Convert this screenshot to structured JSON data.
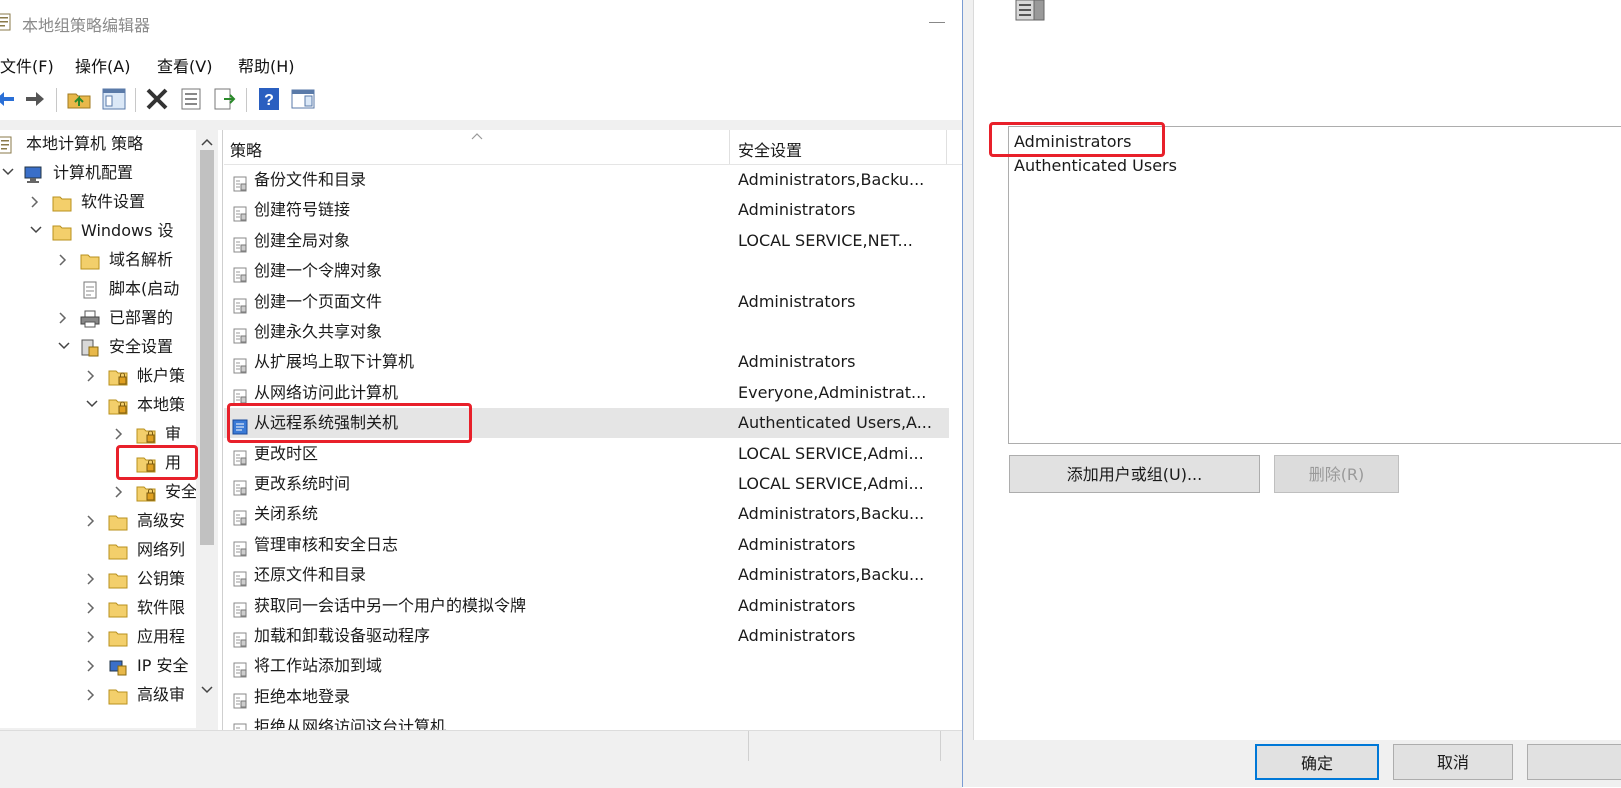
{
  "window": {
    "title": "本地组策略编辑器"
  },
  "menu": {
    "file": "文件(F)",
    "action": "操作(A)",
    "view": "查看(V)",
    "help": "帮助(H)"
  },
  "tree": {
    "items": [
      {
        "label": "本地计算机 策略"
      },
      {
        "label": "计算机配置"
      },
      {
        "label": "软件设置"
      },
      {
        "label": "Windows 设"
      },
      {
        "label": "域名解析"
      },
      {
        "label": "脚本(启动"
      },
      {
        "label": "已部署的"
      },
      {
        "label": "安全设置"
      },
      {
        "label": "帐户策"
      },
      {
        "label": "本地策"
      },
      {
        "label": "审"
      },
      {
        "label": "用"
      },
      {
        "label": "安全"
      },
      {
        "label": "高级安"
      },
      {
        "label": "网络列"
      },
      {
        "label": "公钥策"
      },
      {
        "label": "软件限"
      },
      {
        "label": "应用程"
      },
      {
        "label": "IP 安全"
      },
      {
        "label": "高级审"
      }
    ]
  },
  "list": {
    "col_policy": "策略",
    "col_setting": "安全设置",
    "rows": [
      {
        "name": "备份文件和目录",
        "setting": "Administrators,Backu..."
      },
      {
        "name": "创建符号链接",
        "setting": "Administrators"
      },
      {
        "name": "创建全局对象",
        "setting": "LOCAL SERVICE,NET..."
      },
      {
        "name": "创建一个令牌对象",
        "setting": ""
      },
      {
        "name": "创建一个页面文件",
        "setting": "Administrators"
      },
      {
        "name": "创建永久共享对象",
        "setting": ""
      },
      {
        "name": "从扩展坞上取下计算机",
        "setting": "Administrators"
      },
      {
        "name": "从网络访问此计算机",
        "setting": "Everyone,Administrat..."
      },
      {
        "name": "从远程系统强制关机",
        "setting": "Authenticated Users,A..."
      },
      {
        "name": "更改时区",
        "setting": "LOCAL SERVICE,Admi..."
      },
      {
        "name": "更改系统时间",
        "setting": "LOCAL SERVICE,Admi..."
      },
      {
        "name": "关闭系统",
        "setting": "Administrators,Backu..."
      },
      {
        "name": "管理审核和安全日志",
        "setting": "Administrators"
      },
      {
        "name": "还原文件和目录",
        "setting": "Administrators,Backu..."
      },
      {
        "name": "获取同一会话中另一个用户的模拟令牌",
        "setting": "Administrators"
      },
      {
        "name": "加载和卸载设备驱动程序",
        "setting": "Administrators"
      },
      {
        "name": "将工作站添加到域",
        "setting": ""
      },
      {
        "name": "拒绝本地登录",
        "setting": ""
      },
      {
        "name": "拒绝从网络访问这台计算机",
        "setting": ""
      }
    ]
  },
  "dialog": {
    "users": [
      "Administrators",
      "Authenticated Users"
    ],
    "add_button": "添加用户或组(U)...",
    "remove_button": "删除(R)",
    "ok_button": "确定",
    "cancel_button": "取消"
  },
  "colors": {
    "highlight": "#e8202a",
    "selection": "#e5e5e5",
    "accent": "#0078d7"
  }
}
